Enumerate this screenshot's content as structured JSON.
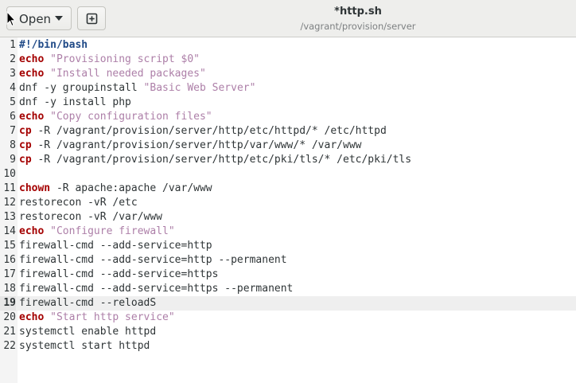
{
  "header": {
    "open_label": "Open",
    "title": "*http.sh",
    "subtitle": "/vagrant/provision/server"
  },
  "editor": {
    "current_line": 19,
    "lines": [
      {
        "num": "1",
        "tokens": [
          {
            "t": "#!/bin/bash",
            "c": "shebang"
          }
        ]
      },
      {
        "num": "2",
        "tokens": [
          {
            "t": "echo",
            "c": "kw"
          },
          {
            "t": " ",
            "c": ""
          },
          {
            "t": "\"Provisioning script $0\"",
            "c": "str2"
          }
        ]
      },
      {
        "num": "3",
        "tokens": [
          {
            "t": "echo",
            "c": "kw"
          },
          {
            "t": " ",
            "c": ""
          },
          {
            "t": "\"Install needed packages\"",
            "c": "str2"
          }
        ]
      },
      {
        "num": "4",
        "tokens": [
          {
            "t": "dnf -y groupinstall ",
            "c": ""
          },
          {
            "t": "\"Basic Web Server\"",
            "c": "str2"
          }
        ]
      },
      {
        "num": "5",
        "tokens": [
          {
            "t": "dnf -y install php",
            "c": ""
          }
        ]
      },
      {
        "num": "6",
        "tokens": [
          {
            "t": "echo",
            "c": "kw"
          },
          {
            "t": " ",
            "c": ""
          },
          {
            "t": "\"Copy configuration files\"",
            "c": "str2"
          }
        ]
      },
      {
        "num": "7",
        "tokens": [
          {
            "t": "cp",
            "c": "kw"
          },
          {
            "t": " -R /vagrant/provision/server/http/etc/httpd/* /etc/httpd",
            "c": ""
          }
        ]
      },
      {
        "num": "8",
        "tokens": [
          {
            "t": "cp",
            "c": "kw"
          },
          {
            "t": " -R /vagrant/provision/server/http/var/www/* /var/www",
            "c": ""
          }
        ]
      },
      {
        "num": "9",
        "tokens": [
          {
            "t": "cp",
            "c": "kw"
          },
          {
            "t": " -R /vagrant/provision/server/http/etc/pki/tls/* /etc/pki/tls",
            "c": ""
          }
        ]
      },
      {
        "num": "10",
        "tokens": []
      },
      {
        "num": "11",
        "tokens": [
          {
            "t": "chown",
            "c": "kw"
          },
          {
            "t": " -R apache:apache /var/www",
            "c": ""
          }
        ]
      },
      {
        "num": "12",
        "tokens": [
          {
            "t": "restorecon -vR /etc",
            "c": ""
          }
        ]
      },
      {
        "num": "13",
        "tokens": [
          {
            "t": "restorecon -vR /var/www",
            "c": ""
          }
        ]
      },
      {
        "num": "14",
        "tokens": [
          {
            "t": "echo",
            "c": "kw"
          },
          {
            "t": " ",
            "c": ""
          },
          {
            "t": "\"Configure firewall\"",
            "c": "str2"
          }
        ]
      },
      {
        "num": "15",
        "tokens": [
          {
            "t": "firewall-cmd --add-service=http",
            "c": ""
          }
        ]
      },
      {
        "num": "16",
        "tokens": [
          {
            "t": "firewall-cmd --add-service=http --permanent",
            "c": ""
          }
        ]
      },
      {
        "num": "17",
        "tokens": [
          {
            "t": "firewall-cmd --add-service=https",
            "c": ""
          }
        ]
      },
      {
        "num": "18",
        "tokens": [
          {
            "t": "firewall-cmd --add-service=https --permanent",
            "c": ""
          }
        ]
      },
      {
        "num": "19",
        "tokens": [
          {
            "t": "firewall-cmd --reloadS",
            "c": ""
          }
        ]
      },
      {
        "num": "20",
        "tokens": [
          {
            "t": "echo",
            "c": "kw"
          },
          {
            "t": " ",
            "c": ""
          },
          {
            "t": "\"Start http service\"",
            "c": "str2"
          }
        ]
      },
      {
        "num": "21",
        "tokens": [
          {
            "t": "systemctl enable httpd",
            "c": ""
          }
        ]
      },
      {
        "num": "22",
        "tokens": [
          {
            "t": "systemctl start httpd",
            "c": ""
          }
        ]
      }
    ]
  },
  "colors": {
    "keyword": "#a40000",
    "string": "#ad7fa8",
    "shebang": "#204a87"
  }
}
